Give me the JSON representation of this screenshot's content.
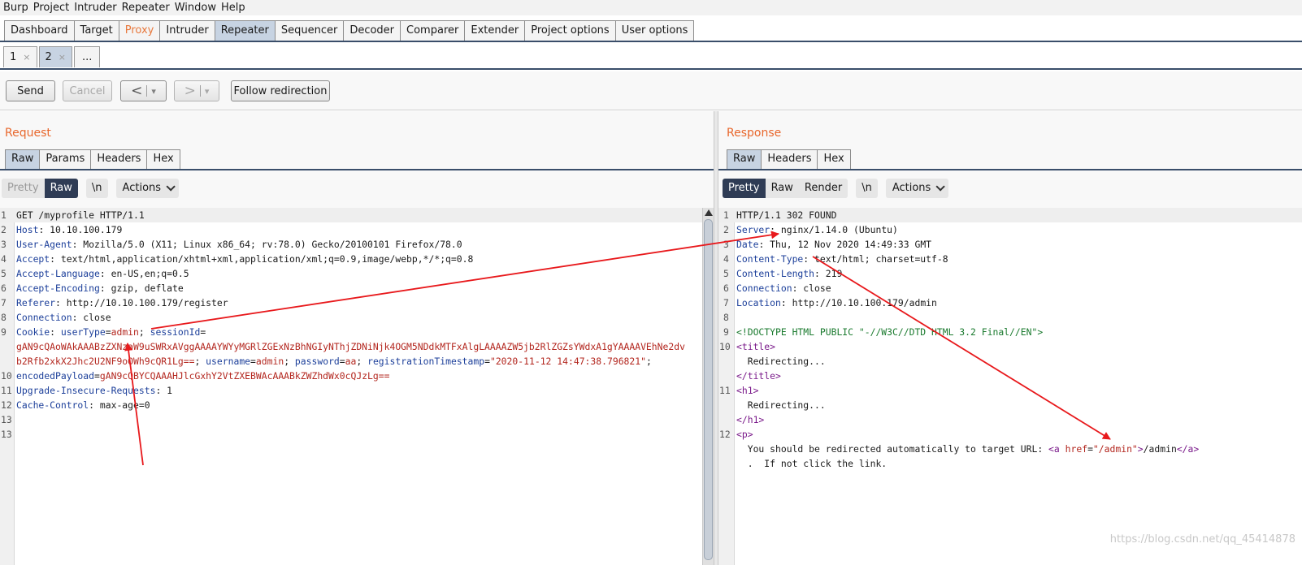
{
  "menu": [
    "Burp",
    "Project",
    "Intruder",
    "Repeater",
    "Window",
    "Help"
  ],
  "main_tabs": [
    {
      "label": "Dashboard",
      "active": false
    },
    {
      "label": "Target",
      "active": false
    },
    {
      "label": "Proxy",
      "active": false
    },
    {
      "label": "Intruder",
      "active": false
    },
    {
      "label": "Repeater",
      "active": true
    },
    {
      "label": "Sequencer",
      "active": false
    },
    {
      "label": "Decoder",
      "active": false
    },
    {
      "label": "Comparer",
      "active": false
    },
    {
      "label": "Extender",
      "active": false
    },
    {
      "label": "Project options",
      "active": false
    },
    {
      "label": "User options",
      "active": false
    }
  ],
  "repeater_tabs": [
    {
      "label": "1",
      "close": "×"
    },
    {
      "label": "2",
      "close": "×"
    },
    {
      "label": "...",
      "close": ""
    }
  ],
  "toolbar": {
    "send": "Send",
    "cancel": "Cancel",
    "back_icon": "<",
    "forward_icon": ">",
    "dropdown_icon": "▾",
    "follow": "Follow redirection"
  },
  "request": {
    "title": "Request",
    "tabs": [
      "Raw",
      "Params",
      "Headers",
      "Hex"
    ],
    "view": {
      "pretty": "Pretty",
      "raw": "Raw",
      "newline": "\\n",
      "actions": "Actions"
    },
    "lines": {
      "l1": "GET /myprofile HTTP/1.1",
      "l2k": "Host",
      "l2v": " 10.10.100.179",
      "l3k": "User-Agent",
      "l3v": " Mozilla/5.0 (X11; Linux x86_64; rv:78.0) Gecko/20100101 Firefox/78.0",
      "l4k": "Accept",
      "l4v": " text/html,application/xhtml+xml,application/xml;q=0.9,image/webp,*/*;q=0.8",
      "l5k": "Accept-Language",
      "l5v": " en-US,en;q=0.5",
      "l6k": "Accept-Encoding",
      "l6v": " gzip, deflate",
      "l7k": "Referer",
      "l7v": " http://10.10.100.179/register",
      "l8k": "Connection",
      "l8v": " close",
      "l9k": "Cookie",
      "c_usertype_k": "userType",
      "c_usertype_v": "admin",
      "c_session_k": "sessionId",
      "c_session_v1": "gAN9cQAoWAkAAABzZXNzaW9uSWRxAVggAAAAYWYyMGRlZGExNzBhNGIyNThjZDNiNjk4OGM5NDdkMTFxAlgLAAAAZW5jb2RlZGZsYWdxA1gYAAAAVEhNe2dv",
      "c_session_v2": "b2Rfb2xkX2Jhc2U2NF9oOWh9cQR1Lg==",
      "c_username_k": "username",
      "c_username_v": "admin",
      "c_password_k": "password",
      "c_password_v": "aa",
      "c_reg_k": "registrationTimestamp",
      "c_reg_v": "\"2020-11-12 14:47:38.796821\"",
      "c_enc_k": "encodedPayload",
      "c_enc_v": "gAN9cQBYCQAAAHJlcGxhY2VtZXEBWAcAAABkZWZhdWx0cQJzLg==",
      "l10k": "Upgrade-Insecure-Requests",
      "l10v": " 1",
      "l11k": "Cache-Control",
      "l11v": " max-age=0"
    },
    "line_numbers": [
      "1",
      "2",
      "3",
      "4",
      "5",
      "6",
      "7",
      "8",
      "9",
      "",
      "",
      "10",
      "11",
      "12",
      "13"
    ]
  },
  "response": {
    "title": "Response",
    "tabs": [
      "Raw",
      "Headers",
      "Hex"
    ],
    "view": {
      "pretty": "Pretty",
      "raw": "Raw",
      "render": "Render",
      "newline": "\\n",
      "actions": "Actions"
    },
    "lines": {
      "l1": "HTTP/1.1 302 FOUND",
      "l2k": "Server",
      "l2v": " nginx/1.14.0 (Ubuntu)",
      "l3k": "Date",
      "l3v": " Thu, 12 Nov 2020 14:49:33 GMT",
      "l4k": "Content-Type",
      "l4v": " text/html; charset=utf-8",
      "l5k": "Content-Length",
      "l5v": " 219",
      "l6k": "Connection",
      "l6v": " close",
      "l7k": "Location",
      "l7v": " http://10.10.100.179/admin",
      "l9": "<!DOCTYPE HTML PUBLIC \"-//W3C//DTD HTML 3.2 Final//EN\">",
      "title_open": "<title>",
      "title_text": "  Redirecting...",
      "title_close": "</title>",
      "h1_open": "<h1>",
      "h1_text": "  Redirecting...",
      "h1_close": "</h1>",
      "p_open": "<p>",
      "p_text": "  You should be redirected automatically to target URL: ",
      "a_open": "<a ",
      "a_attr": "href",
      "a_eq": "=",
      "a_val": "\"/admin\"",
      "a_gt": ">",
      "a_text": "/admin",
      "a_close": "</a>",
      "p_tail": "  .  If not click the link."
    },
    "line_numbers": [
      "1",
      "2",
      "3",
      "4",
      "5",
      "6",
      "7",
      "8",
      "9",
      "10",
      "",
      "",
      "11",
      "",
      "",
      "12",
      "",
      ""
    ]
  },
  "watermark": "https://blog.csdn.net/qq_45414878",
  "colors": {
    "accent_orange": "#e8672c",
    "header_key": "#1c3f9a",
    "cookie_value": "#b3261e",
    "arrow": "#e8191c"
  }
}
